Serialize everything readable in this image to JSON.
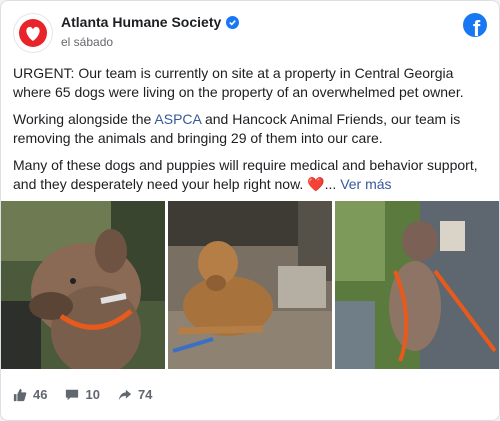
{
  "header": {
    "page_name": "Atlanta Humane Society",
    "timestamp": "el sábado"
  },
  "post": {
    "paragraph1": "URGENT: Our team is currently on site at a property in Central Georgia where 65 dogs were living on the property of an overwhelmed pet owner.",
    "p2_before": "Working alongside the ",
    "p2_link": "ASPCA",
    "p2_after": " and Hancock Animal Friends, our team is removing the animals and bringing 29 of them into our care.",
    "p3_text": "Many of these dogs and puppies will require medical and behavior support, and they desperately need your help right now. ",
    "p3_heart": "❤️",
    "p3_ellipsis": "... ",
    "see_more": "Ver más"
  },
  "photos": [
    {
      "icon": "dog-with-orange-leash-photo"
    },
    {
      "icon": "dog-lying-on-ground-photo"
    },
    {
      "icon": "rescuer-holding-dog-photo"
    }
  ],
  "footer": {
    "likes": "46",
    "comments": "10",
    "shares": "74"
  },
  "colors": {
    "brand_blue": "#1877f2",
    "link": "#385898",
    "heart_red": "#e41e3f"
  }
}
